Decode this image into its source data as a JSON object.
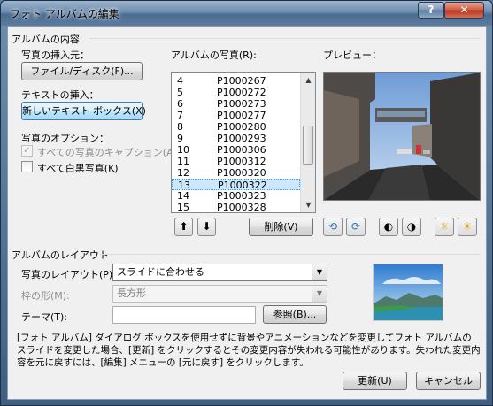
{
  "window": {
    "title": "フォト アルバムの編集",
    "help_glyph": "?",
    "close_glyph": "✕"
  },
  "album_content": {
    "group_label": "アルバムの内容",
    "insert_photo_label": "写真の挿入元：",
    "file_disk_button": "ファイル/ディスク(F)...",
    "insert_text_label": "テキストの挿入：",
    "new_textbox_button": "新しいテキスト ボックス(X)",
    "photo_options_label": "写真のオプション：",
    "caption_all_label": "すべての写真のキャプション(A)",
    "caption_all_checked": true,
    "caption_all_disabled": true,
    "all_bw_label": "すべて白黒写真(K)",
    "all_bw_checked": false
  },
  "photo_list": {
    "label": "アルバムの写真(R):",
    "selected_index": 9,
    "rows": [
      {
        "num": "4",
        "name": "P1000267"
      },
      {
        "num": "5",
        "name": "P1000272"
      },
      {
        "num": "6",
        "name": "P1000273"
      },
      {
        "num": "7",
        "name": "P1000277"
      },
      {
        "num": "8",
        "name": "P1000280"
      },
      {
        "num": "9",
        "name": "P1000293"
      },
      {
        "num": "10",
        "name": "P1000306"
      },
      {
        "num": "11",
        "name": "P1000312"
      },
      {
        "num": "12",
        "name": "P1000320"
      },
      {
        "num": "13",
        "name": "P1000322"
      },
      {
        "num": "14",
        "name": "P1000323"
      },
      {
        "num": "15",
        "name": "P1000328"
      }
    ],
    "move_up_glyph": "⬆",
    "move_down_glyph": "⬇",
    "delete_button": "削除(V)"
  },
  "preview": {
    "label": "プレビュー："
  },
  "album_layout": {
    "group_label": "アルバムのレイアウト",
    "picture_layout_label": "写真のレイアウト(P):",
    "picture_layout_value": "スライドに合わせる",
    "frame_shape_label": "枠の形(M):",
    "frame_shape_value": "長方形",
    "frame_shape_disabled": true,
    "theme_label": "テーマ(T):",
    "theme_value": "",
    "browse_button": "参照(B)..."
  },
  "description": "[フォト アルバム] ダイアログ ボックスを使用せずに背景やアニメーションなどを変更してフォト アルバムのスライドを変更した場合、[更新] をクリックするとその変更内容が失われる可能性があります。失われた変更内容を元に戻すには、[編集] メニューの [元に戻す] をクリックします。",
  "footer": {
    "update_button": "更新(U)",
    "cancel_button": "キャンセル"
  }
}
